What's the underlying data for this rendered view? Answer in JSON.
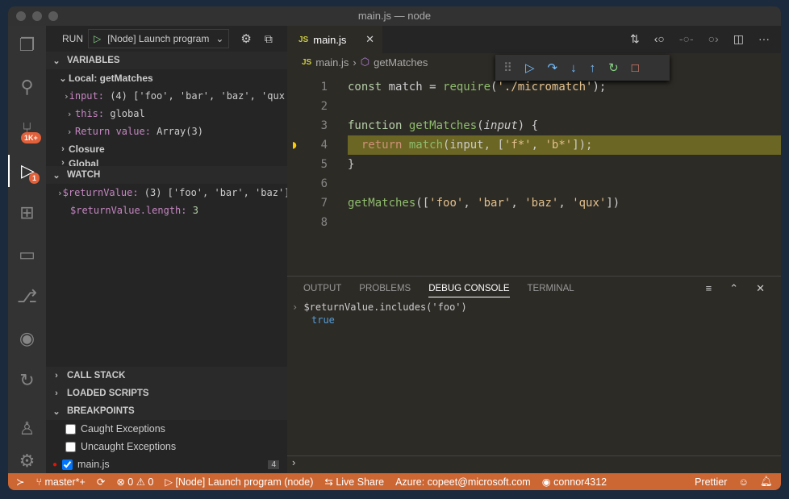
{
  "window": {
    "title": "main.js — node"
  },
  "activity": {
    "scm_badge": "1K+",
    "debug_badge": "1"
  },
  "sidebar": {
    "run_label": "RUN",
    "config": "[Node] Launch program",
    "variables_title": "VARIABLES",
    "scope": "Local: getMatches",
    "vars": [
      {
        "name": "input",
        "value": "(4) ['foo', 'bar', 'baz', 'qux']"
      },
      {
        "name": "this",
        "value": "global"
      },
      {
        "name": "Return value",
        "value": "Array(3)"
      }
    ],
    "closure": "Closure",
    "global": "Global",
    "watch_title": "WATCH",
    "watch": [
      {
        "name": "$returnValue",
        "value": "(3) ['foo', 'bar', 'baz']"
      },
      {
        "name": "$returnValue.length",
        "value": "3"
      }
    ],
    "callstack": "CALL STACK",
    "loaded": "LOADED SCRIPTS",
    "breakpoints": "BREAKPOINTS",
    "bps": [
      {
        "label": "Caught Exceptions",
        "checked": false
      },
      {
        "label": "Uncaught Exceptions",
        "checked": false
      },
      {
        "label": "main.js",
        "checked": true,
        "count": "4"
      }
    ]
  },
  "editor": {
    "tab": "main.js",
    "file_icon": "JS",
    "crumb_file": "main.js",
    "crumb_symbol": "getMatches",
    "lines": [
      "1",
      "2",
      "3",
      "4",
      "5",
      "6",
      "7",
      "8"
    ]
  },
  "panel": {
    "tabs": [
      "OUTPUT",
      "PROBLEMS",
      "DEBUG CONSOLE",
      "TERMINAL"
    ],
    "input": "$returnValue.includes('foo')",
    "output": "true"
  },
  "status": {
    "branch": "master*+",
    "errors": "0",
    "warnings": "0",
    "launch": "[Node] Launch program (node)",
    "liveshare": "Live Share",
    "azure": "Azure: copeet@microsoft.com",
    "github": "connor4312",
    "prettier": "Prettier"
  },
  "colors": {
    "status": "#cc6633",
    "highlight": "#6b6624"
  }
}
